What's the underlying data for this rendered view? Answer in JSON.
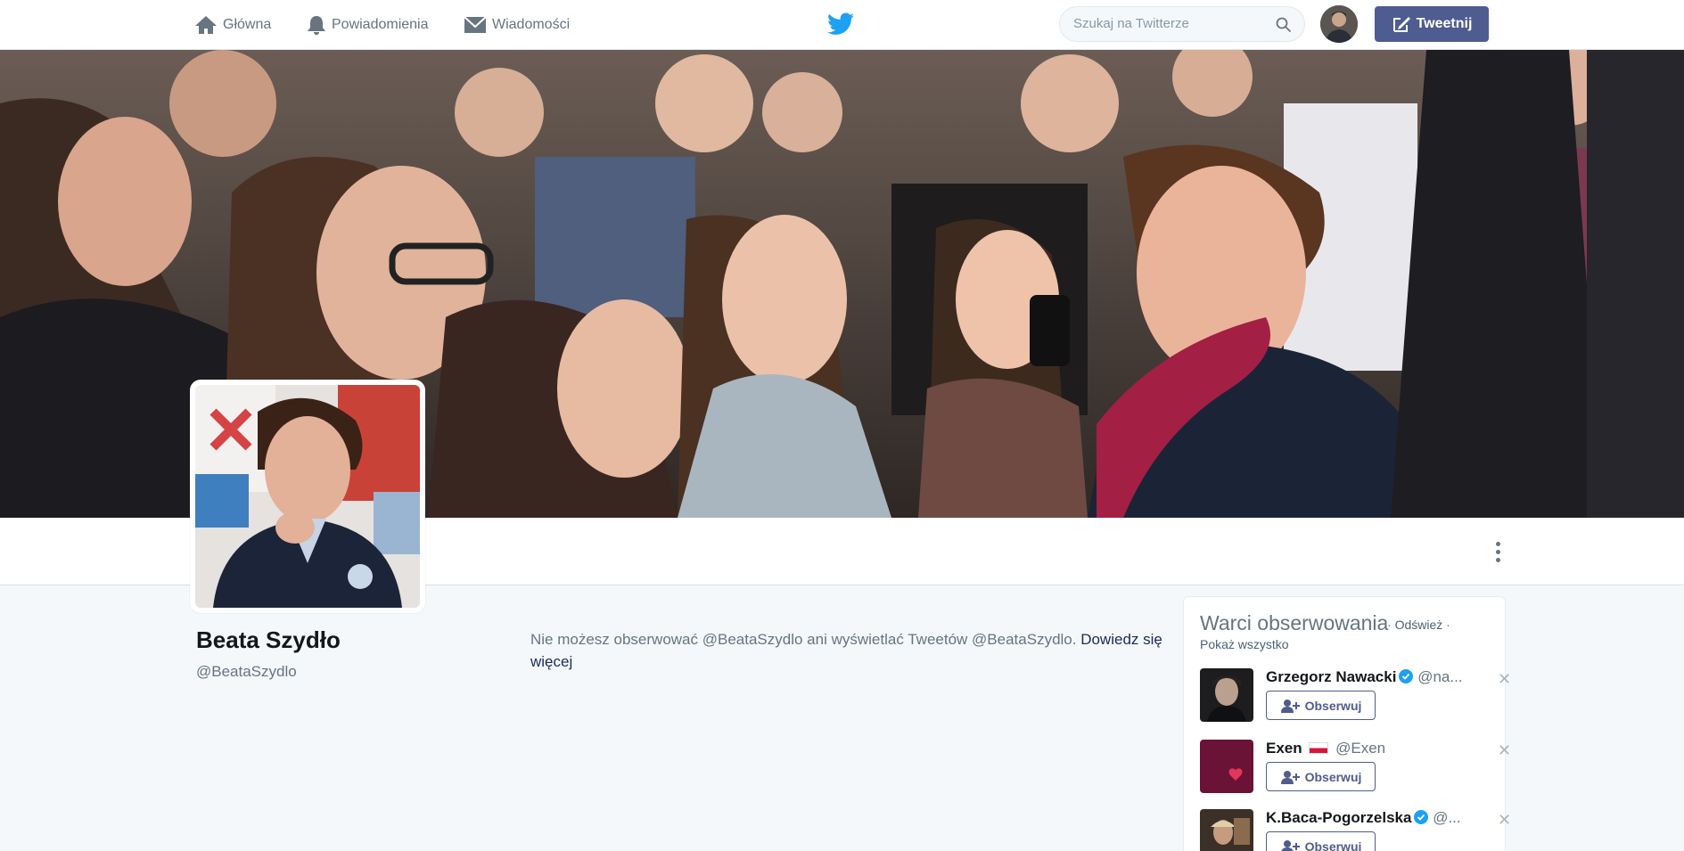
{
  "nav": {
    "home_label": "Główna",
    "notifications_label": "Powiadomienia",
    "messages_label": "Wiadomości",
    "search_placeholder": "Szukaj na Twitterze",
    "tweet_label": "Tweetnij"
  },
  "profile": {
    "name": "Beata Szydło",
    "handle": "@BeataSzydlo",
    "blocked_text": "Nie możesz obserwować @BeataSzydlo ani wyświetlać Tweetów @BeataSzydlo. ",
    "learn_more": "Dowiedz się więcej"
  },
  "who_to_follow": {
    "title": "Warci obserwowania",
    "refresh": "Odśwież",
    "show_all": "Pokaż wszystko",
    "follow_label": "Obserwuj",
    "users": [
      {
        "name": "Grzegorz Nawacki",
        "handle": "@na...",
        "verified": true
      },
      {
        "name": "Exen",
        "flag": "🇵🇱",
        "handle": "@Exen",
        "verified": false
      },
      {
        "name": "K.Baca-Pogorzelska",
        "handle": "@...",
        "verified": true
      }
    ]
  },
  "colors": {
    "accent": "#4f5c8f",
    "twitter_blue": "#1da1f2",
    "background": "#f5f8fa"
  }
}
